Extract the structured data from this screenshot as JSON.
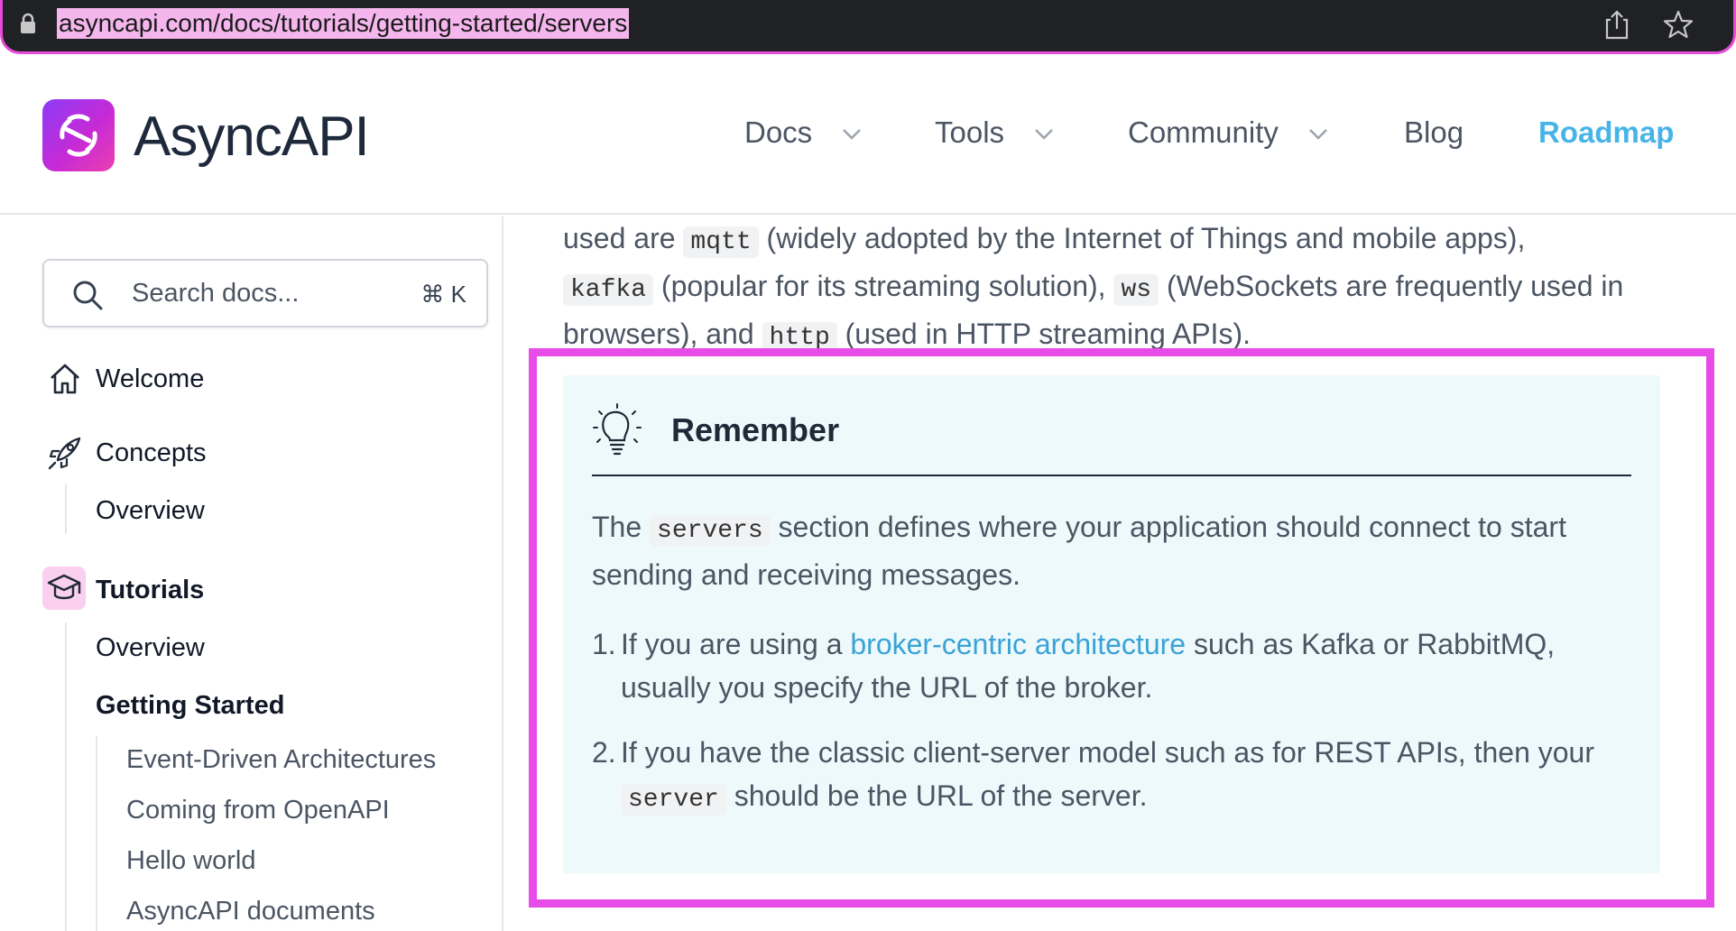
{
  "browser": {
    "url": "asyncapi.com/docs/tutorials/getting-started/servers"
  },
  "header": {
    "logo_text": "AsyncAPI",
    "nav": [
      {
        "label": "Docs",
        "dropdown": true
      },
      {
        "label": "Tools",
        "dropdown": true
      },
      {
        "label": "Community",
        "dropdown": true
      },
      {
        "label": "Blog",
        "dropdown": false
      },
      {
        "label": "Roadmap",
        "dropdown": false
      }
    ],
    "roadmap_color": "#47b4e8"
  },
  "sidebar": {
    "search_placeholder": "Search docs...",
    "search_shortcut": "⌘ K",
    "items": [
      {
        "label": "Welcome",
        "icon": "home-icon"
      },
      {
        "label": "Concepts",
        "icon": "rocket-icon"
      },
      {
        "label": "Overview"
      },
      {
        "label": "Tutorials",
        "icon": "graduation-cap-icon"
      },
      {
        "label": "Overview"
      },
      {
        "label": "Getting Started"
      },
      {
        "label": "Event-Driven Architectures"
      },
      {
        "label": "Coming from OpenAPI"
      },
      {
        "label": "Hello world"
      },
      {
        "label": "AsyncAPI documents"
      }
    ]
  },
  "content": {
    "intro": {
      "t1": "used are ",
      "c1": "mqtt",
      "t2": " (widely adopted by the Internet of Things and mobile apps),",
      "c2": "kafka",
      "t3": " (popular for its streaming solution), ",
      "c3": "ws",
      "t4": " (WebSockets are frequently used in browsers), and ",
      "c4": "http",
      "t5": " (used in HTTP streaming APIs)."
    },
    "callout": {
      "title": "Remember",
      "body_t1": "The ",
      "body_code": "servers",
      "body_t2": " section defines where your application should connect to start sending and receiving messages.",
      "item1_num": "1.",
      "item1_t1": "If you are using a ",
      "item1_link": "broker-centric architecture",
      "item1_t2": " such as Kafka or RabbitMQ, usually you specify the URL of the broker.",
      "item2_num": "2.",
      "item2_t1": "If you have the classic client-server model such as for REST APIs, then your ",
      "item2_code": "server",
      "item2_t2": " should be the URL of the server."
    }
  },
  "colors": {
    "highlight": "#e74be8",
    "callout_bg": "#eef9fc",
    "link": "#3aa3d6"
  }
}
